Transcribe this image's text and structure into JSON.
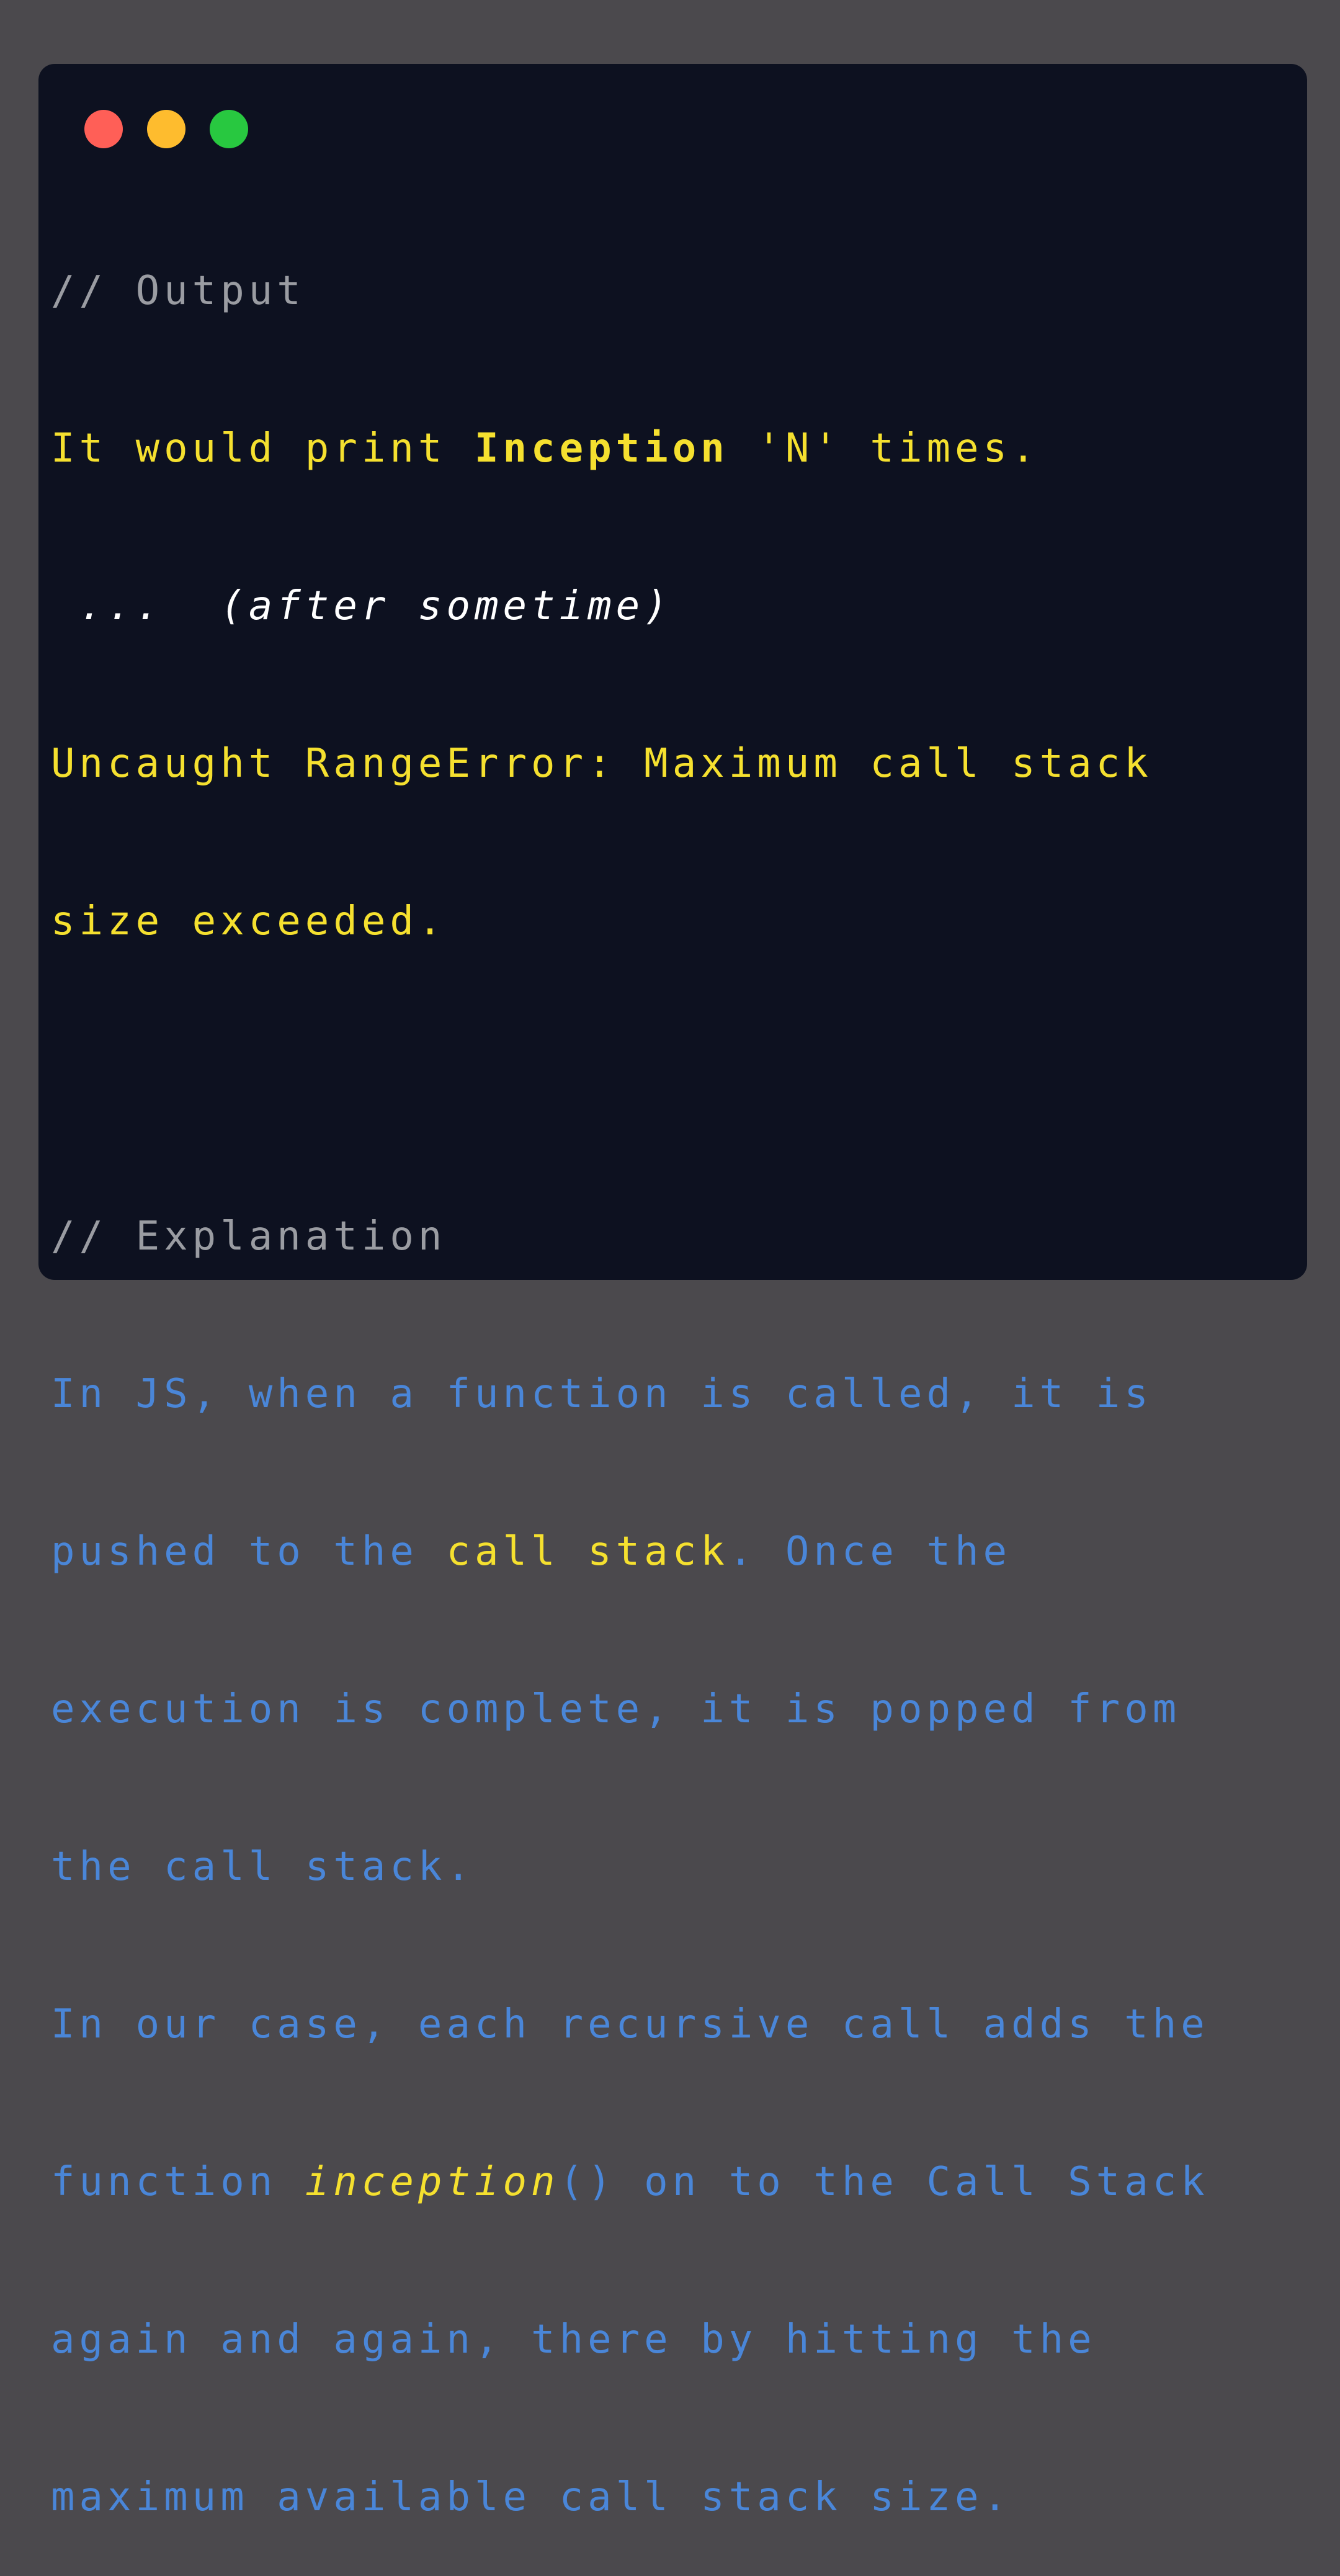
{
  "window": {
    "controls": [
      "close",
      "minimize",
      "maximize"
    ],
    "colors": {
      "close": "#ff5f57",
      "minimize": "#febc2e",
      "maximize": "#28c840"
    }
  },
  "theme": {
    "background": "#0d1120",
    "comment": "#9a9ca2",
    "yellow": "#f5e02f",
    "blue": "#4a86d8",
    "white": "#ffffff"
  },
  "output": {
    "comment": "// Output",
    "line1_a": "It would print ",
    "line1_bold": "Inception",
    "line1_b": " 'N' times.",
    "line2": " ...  (after sometime)",
    "line3": "Uncaught RangeError: Maximum call stack",
    "line4": "size exceeded."
  },
  "explanation": {
    "comment": "// Explanation",
    "line1": "In JS, when a function is called, it is",
    "line2_a": "pushed to the ",
    "line2_hl": "call stack",
    "line2_b": ". Once the",
    "line3": "execution is complete, it is popped from",
    "line4": "the call stack.",
    "line5": "In our case, each recursive call adds the",
    "line6_a": "function ",
    "line6_fn": "inception",
    "line6_b": "() on to the Call Stack",
    "line7": "again and again, there by hitting the",
    "line8": "maximum available call stack size."
  }
}
